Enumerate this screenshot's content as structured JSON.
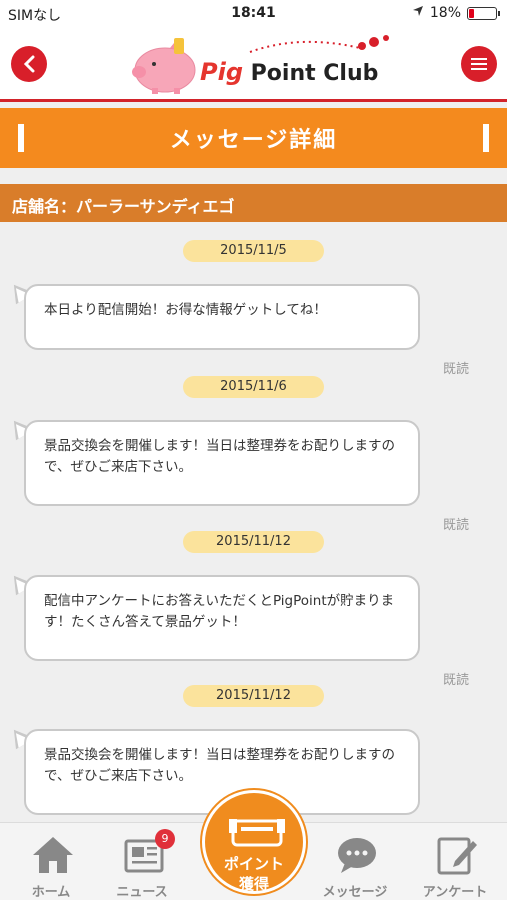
{
  "status_bar": {
    "carrier": "SIMなし",
    "time": "18:41",
    "battery": "18%",
    "battery_level": 0.18
  },
  "header": {
    "logo_pig": "Pig",
    "logo_rest": "Point Club"
  },
  "title_bar": {
    "title": "メッセージ詳細"
  },
  "store": {
    "label": "店舗名：パーラーサンディエゴ"
  },
  "messages": [
    {
      "date": "2015/11/5",
      "text": "本日より配信開始！お得な情報ゲットしてね！",
      "read": "既読"
    },
    {
      "date": "2015/11/6",
      "text": "景品交換会を開催します！当日は整理券をお配りしますので、ぜひご来店下さい。",
      "read": "既読"
    },
    {
      "date": "2015/11/12",
      "text": "配信中アンケートにお答えいただくとPigPointが貯まります！たくさん答えて景品ゲット！",
      "read": "既読"
    },
    {
      "date": "2015/11/12",
      "text": "景品交換会を開催します！当日は整理券をお配りしますので、ぜひご来店下さい。",
      "read": ""
    }
  ],
  "tabs": {
    "home": {
      "label": "ホーム",
      "icon": "home-icon"
    },
    "news": {
      "label": "ニュース",
      "icon": "newspaper-icon",
      "badge": "9"
    },
    "points": {
      "label_line1": "ポイント",
      "label_line2": "獲得",
      "icon": "pig-icon"
    },
    "message": {
      "label": "メッセージ",
      "icon": "chat-bubble-icon"
    },
    "survey": {
      "label": "アンケート",
      "icon": "pencil-note-icon"
    }
  },
  "colors": {
    "accent": "#f48a1e",
    "brand_red": "#d81f2a",
    "store_bar": "#d97d2a",
    "date_pill": "#fbe39c"
  }
}
